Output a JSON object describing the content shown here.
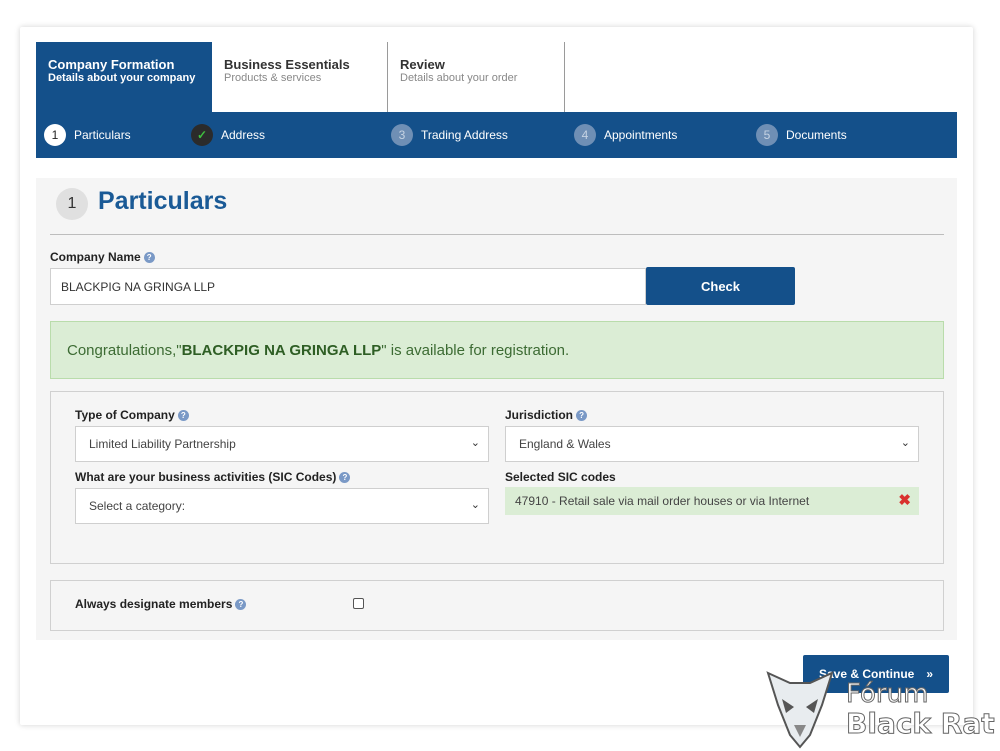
{
  "tabs": [
    {
      "title": "Company Formation",
      "subtitle": "Details about your company"
    },
    {
      "title": "Business Essentials",
      "subtitle": "Products & services"
    },
    {
      "title": "Review",
      "subtitle": "Details about your order"
    }
  ],
  "steps": [
    {
      "num": "1",
      "label": "Particulars",
      "state": "active"
    },
    {
      "num": "✓",
      "label": "Address",
      "state": "done"
    },
    {
      "num": "3",
      "label": "Trading Address",
      "state": "pending"
    },
    {
      "num": "4",
      "label": "Appointments",
      "state": "pending"
    },
    {
      "num": "5",
      "label": "Documents",
      "state": "pending"
    }
  ],
  "section": {
    "number": "1",
    "title": "Particulars"
  },
  "company_name": {
    "label": "Company Name",
    "value": "BLACKPIG NA GRINGA LLP",
    "check_label": "Check"
  },
  "availability": {
    "prefix": "Congratulations,\"",
    "name": "BLACKPIG NA GRINGA LLP",
    "suffix": "\" is available for registration."
  },
  "type_of_company": {
    "label": "Type of Company",
    "value": "Limited Liability Partnership"
  },
  "jurisdiction": {
    "label": "Jurisdiction",
    "value": "England & Wales"
  },
  "sic": {
    "label": "What are your business activities (SIC Codes)",
    "placeholder": "Select a category:"
  },
  "selected_sic": {
    "label": "Selected SIC codes",
    "items": [
      "47910 - Retail sale via mail order houses or via Internet"
    ]
  },
  "designate": {
    "label": "Always designate members",
    "checked": false
  },
  "save_label": "Save & Continue",
  "save_icon": "»",
  "watermark": {
    "line1": "Fórum",
    "line2": "Black Rat"
  },
  "colors": {
    "primary": "#14508a",
    "success_bg": "#dbedd5",
    "heading": "#1a5a96",
    "remove": "#d9312e"
  }
}
